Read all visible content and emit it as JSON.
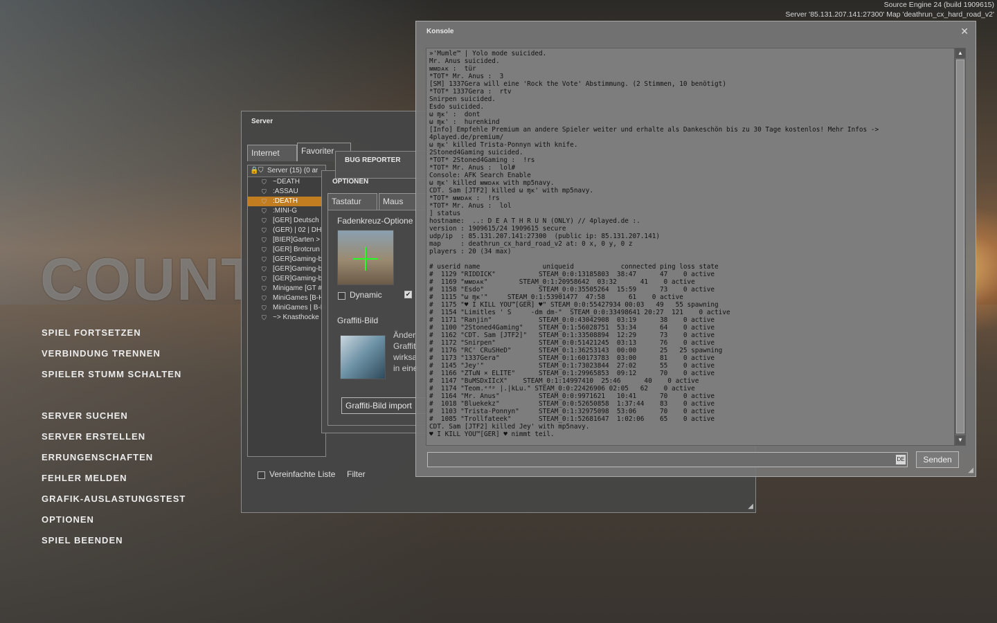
{
  "engine": {
    "build": "Source Engine 24 (build 1909615)",
    "server_line": "Server '85.131.207.141:27300' Map 'deathrun_cx_hard_road_v2'"
  },
  "logo_text": "COUNT",
  "main_menu": [
    "SPIEL FORTSETZEN",
    "VERBINDUNG TRENNEN",
    "SPIELER STUMM SCHALTEN",
    "SERVER SUCHEN",
    "SERVER ERSTELLEN",
    "ERRUNGENSCHAFTEN",
    "FEHLER MELDEN",
    "GRAFIK-AUSLASTUNGSTEST",
    "OPTIONEN",
    "SPIEL BEENDEN"
  ],
  "server_window": {
    "title": "Server",
    "tabs": [
      "Internet",
      "Favoriter"
    ],
    "list_header": "Server (15) (0 ar",
    "rows": [
      "~DEATH",
      ":ASSAU",
      ":DEATH",
      ":MINI-G",
      "[GER] Deutsch",
      "(GER) | 02 | DH",
      "[BIER]Garten >",
      "[GER] Brotcrun",
      "[GER]Gaming-b",
      "[GER]Gaming-b",
      "[GER]Gaming-b",
      "Minigame [GT #",
      "MiniGames [B-H",
      "MiniGames | B-H",
      "~> Knasthocke"
    ],
    "selected_row": 2,
    "simplified_label": "Vereinfachte Liste",
    "filter_label": "Filter"
  },
  "bug_reporter": {
    "title": "BUG REPORTER"
  },
  "options_window": {
    "title": "OPTIONEN",
    "tabs": [
      "Tastatur",
      "Maus"
    ],
    "crosshair_label": "Fadenkreuz-Optione",
    "dynamic_label": "Dynamic",
    "graffiti_label": "Graffiti-Bild",
    "graffiti_desc": [
      "Änder",
      "Graffit",
      "wirksa",
      "in eine"
    ],
    "graffiti_import": "Graffiti-Bild import"
  },
  "console": {
    "title": "Konsole",
    "close": "✕",
    "lines": [
      "»'Mumle™ | Yolo mode suicided.",
      "Mr. Anus suicided.",
      "ᴍᴍᴅᴀᴋ :  tür",
      "*TOT* Mr. Anus :  3",
      "[SM] 1337Gera will eine 'Rock the Vote' Abstimmung. (2 Stimmen, 10 benötigt)",
      "*TOT* 1337Gera :  rtv",
      "Snirpen suicided.",
      "Esdo suicided.",
      "ω ɱᴋ' :  dont",
      "ω ɱᴋ' :  hurenkind",
      "[Info] Empfehle Premium an andere Spieler weiter und erhalte als Dankeschön bis zu 30 Tage kostenlos! Mehr Infos ->",
      "4played.de/premium/",
      "ω ɱᴋ' killed Trista-Ponnyn with knife.",
      "2Stoned4Gaming suicided.",
      "*TOT* 2Stoned4Gaming :  !rs",
      "*TOT* Mr. Anus :  lol#",
      "Console: AFK Search Enable",
      "ω ɱᴋ' killed ᴍᴍᴅᴀᴋ with mp5navy.",
      "CDT. Sam [JTF2] killed ω ɱᴋ' with mp5navy.",
      "*TOT* ᴍᴍᴅᴀᴋ :  !rs",
      "*TOT* Mr. Anus :  lol",
      "] status",
      "hostname:  ..: D E A T H R U N (ONLY) // 4played.de :.",
      "version : 1909615/24 1909615 secure",
      "udp/ip  : 85.131.207.141:27300  (public ip: 85.131.207.141)",
      "map     : deathrun_cx_hard_road_v2 at: 0 x, 0 y, 0 z",
      "players : 20 (34 max)",
      "",
      "# userid name                uniqueid            connected ping loss state",
      "#  1129 \"RIDDICK\"           STEAM_0:0:13185803  38:47      47    0 active",
      "#  1169 \"ᴍᴍᴅᴀᴋ\"        STEAM_0:1:20958642  03:32      41    0 active",
      "#  1158 \"Esdo\"              STEAM_0:0:35505264  15:59      73    0 active",
      "#  1115 \"ω ɱᴋ'\"     STEAM_0:1:53901477  47:58      61    0 active",
      "#  1175 \"♥ I KILL YOU™[GER] ♥\" STEAM_0:0:55427934 00:03   49   55 spawning",
      "#  1154 \"Limitles ' S     -dm dm-\"  STEAM_0:0:33498641 20:27  121    0 active",
      "#  1171 \"Ranjin\"            STEAM_0:0:43042908  03:19      38    0 active",
      "#  1100 \"2Stoned4Gaming\"    STEAM_0:1:56028751  53:34      64    0 active",
      "#  1162 \"CDT. Sam [JTF2]\"   STEAM_0:1:33508894  12:29      73    0 active",
      "#  1172 \"Snirpen\"           STEAM_0:0:51421245  03:13      76    0 active",
      "#  1176 \"RC' CRuSHeD\"       STEAM_0:1:36253143  00:00      25   25 spawning",
      "#  1173 \"1337Gera\"          STEAM_0:1:60173783  03:00      81    0 active",
      "#  1145 \"Jey'\"              STEAM_0:1:73023844  27:02      55    0 active",
      "#  1166 \"ZTuN × ELITE\"      STEAM_0:1:29965853  09:12      70    0 active",
      "#  1147 \"BuMSDxIIcX\"    STEAM_0:1:14997410  25:46      40    0 active",
      "#  1174 \"Teom.ᵉᵈᵖ |.|kLu.\" STEAM_0:0:22426906 02:05   62    0 active",
      "#  1164 \"Mr. Anus\"          STEAM_0:0:9971621   10:41      70    0 active",
      "#  1018 \"Bluekekz\"          STEAM_0:0:52650858  1:37:44    83    0 active",
      "#  1103 \"Trista-Ponnyn\"     STEAM_0:1:32975098  53:06      70    0 active",
      "#  1085 \"Trollfateek\"       STEAM_0:1:52681647  1:02:06    65    0 active",
      "CDT. Sam [JTF2] killed Jey' with mp5navy.",
      "♥ I KILL YOU™[GER] ♥ nimmt teil."
    ],
    "input_value": "",
    "lang_badge": "DE",
    "send_label": "Senden"
  }
}
